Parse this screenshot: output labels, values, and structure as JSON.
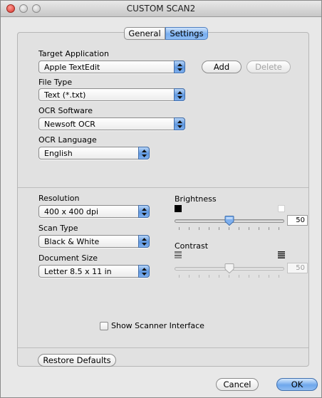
{
  "window": {
    "title": "CUSTOM SCAN2"
  },
  "tabs": [
    {
      "label": "General",
      "selected": false
    },
    {
      "label": "Settings",
      "selected": true
    }
  ],
  "target_application": {
    "label": "Target Application",
    "value": "Apple TextEdit",
    "add_label": "Add",
    "delete_label": "Delete"
  },
  "file_type": {
    "label": "File Type",
    "value": "Text (*.txt)"
  },
  "ocr_software": {
    "label": "OCR Software",
    "value": "Newsoft OCR"
  },
  "ocr_language": {
    "label": "OCR Language",
    "value": "English"
  },
  "resolution": {
    "label": "Resolution",
    "value": "400 x 400 dpi"
  },
  "scan_type": {
    "label": "Scan Type",
    "value": "Black & White"
  },
  "document_size": {
    "label": "Document Size",
    "value": "Letter  8.5 x 11 in"
  },
  "brightness": {
    "label": "Brightness",
    "value": "50",
    "level_fraction": 0.5
  },
  "contrast": {
    "label": "Contrast",
    "value": "50",
    "level_fraction": 0.5,
    "enabled": false
  },
  "show_scanner_interface": {
    "label": "Show Scanner Interface",
    "checked": false
  },
  "restore_defaults_label": "Restore Defaults",
  "cancel_label": "Cancel",
  "ok_label": "OK",
  "colors": {
    "accent": "#6ea7ec",
    "close": "#d8322a"
  }
}
